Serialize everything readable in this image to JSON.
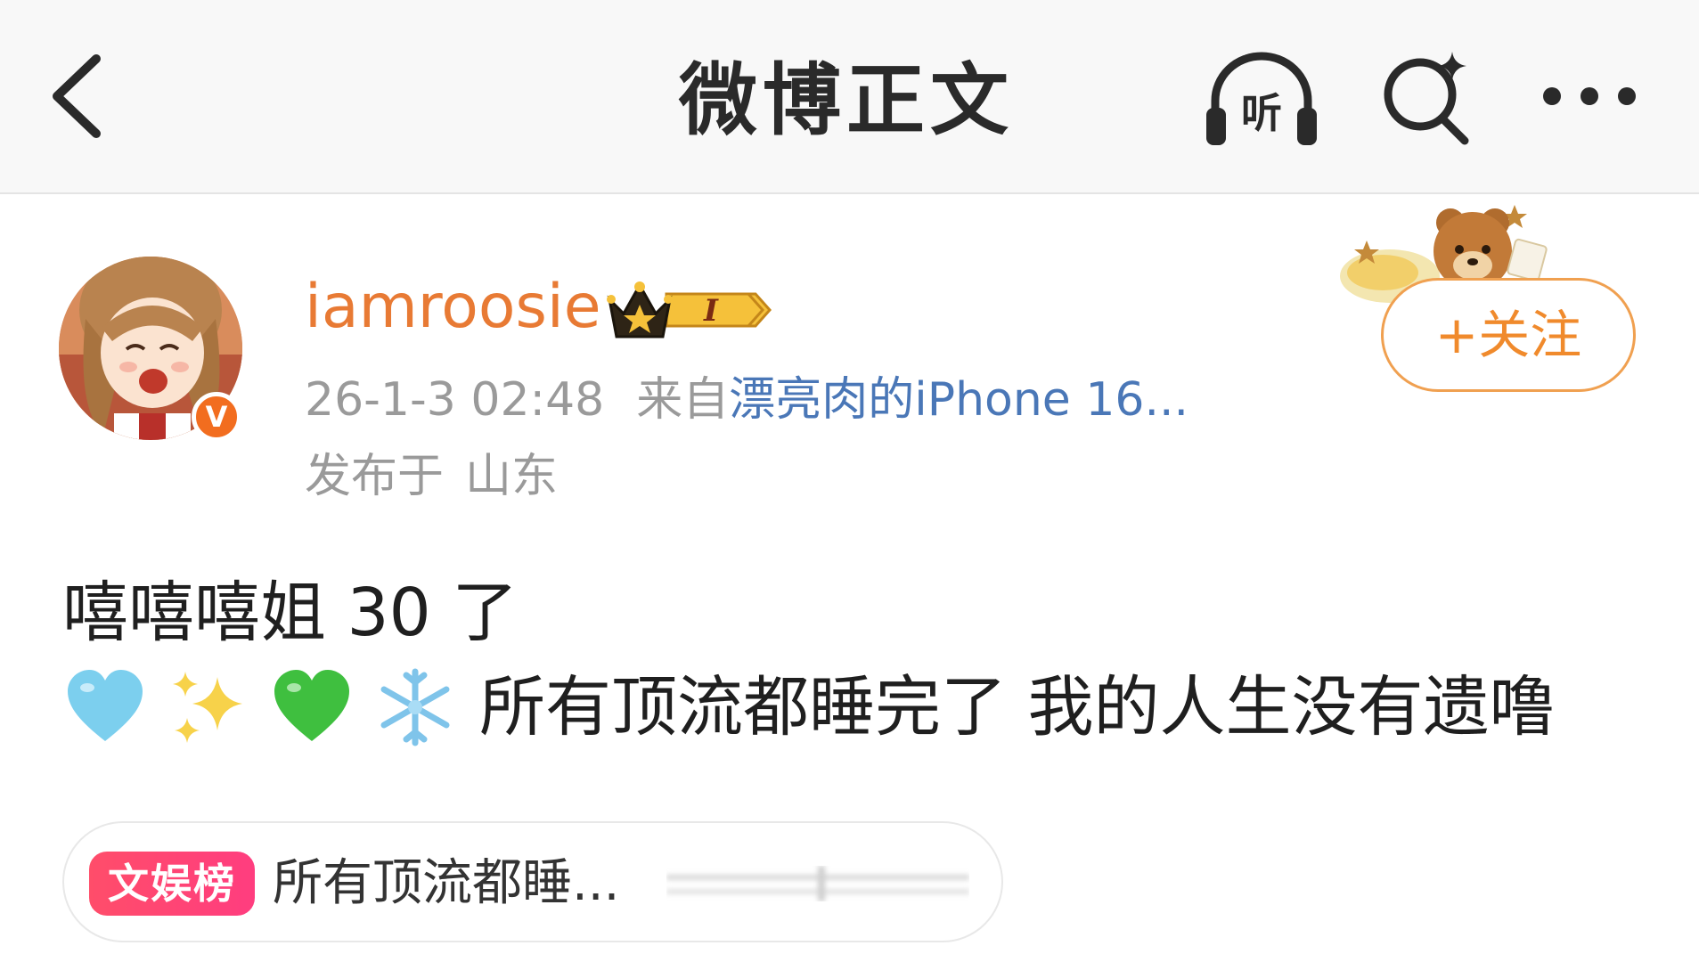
{
  "header": {
    "title": "微博正文",
    "listen_label": "听"
  },
  "post": {
    "author": {
      "username": "iamroosie",
      "vip_level": "I",
      "verified_mark": "V"
    },
    "time": "26-1-3 02:48",
    "source_prefix": "来自",
    "source_link": "漂亮肉的iPhone 16...",
    "location_prefix": "发布于",
    "location": "山东",
    "follow_label": "+关注",
    "line1": "嘻嘻嘻姐 30 了",
    "line2": "所有顶流都睡完了 我的人生没有遗噜",
    "emojis": [
      "light-blue-heart",
      "sparkles",
      "green-heart",
      "snowflake"
    ]
  },
  "topic": {
    "badge": "文娱榜",
    "text": "所有顶流都睡..."
  },
  "colors": {
    "username": "#e87a34",
    "link": "#4a77b7",
    "follow": "#f08a2c",
    "topic_badge": "#ff4d6a",
    "verified": "#f26d1f"
  }
}
